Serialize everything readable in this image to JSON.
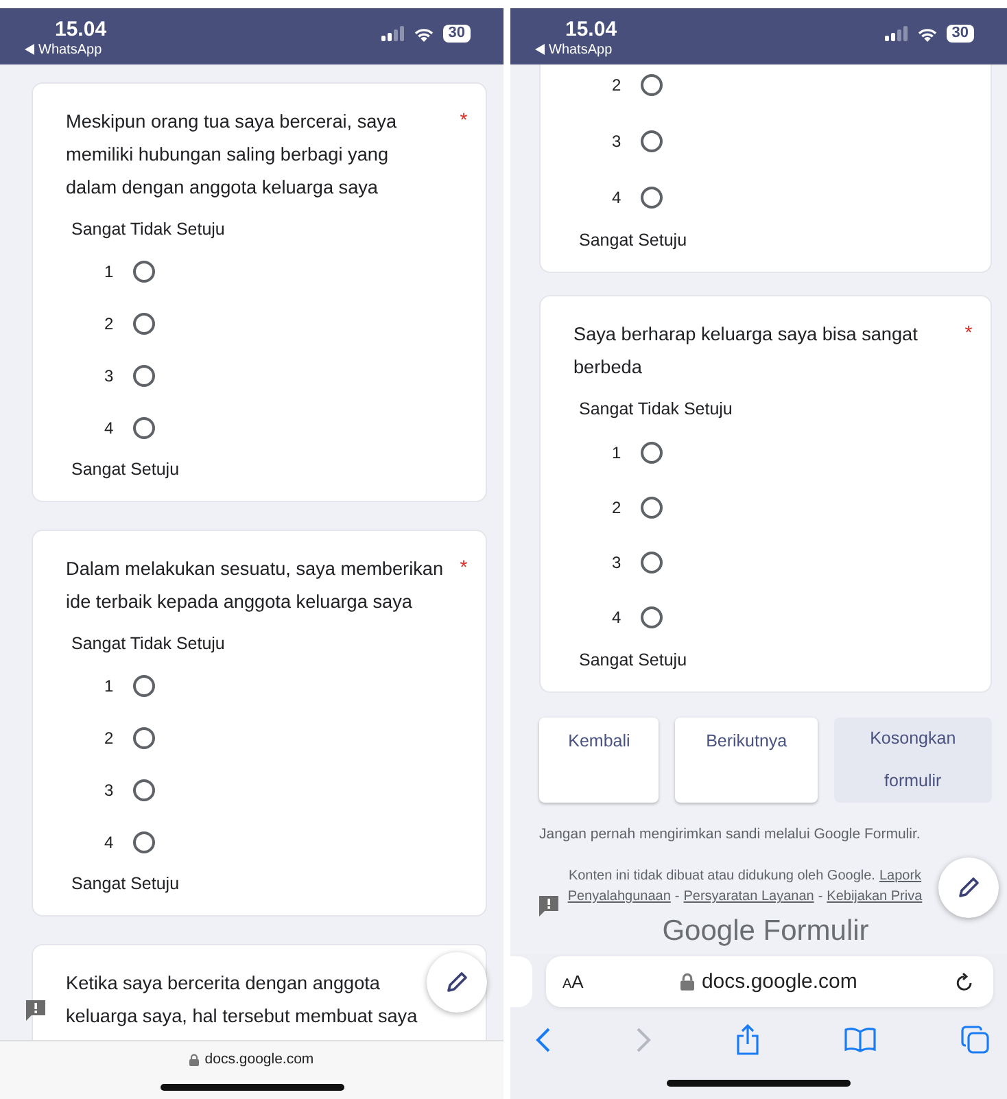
{
  "screens": [
    {
      "status_bar": {
        "time": "15.04",
        "back_app": "WhatsApp",
        "battery": "30"
      },
      "cards": [
        {
          "title": "Meskipun orang tua saya bercerai, saya\nmemiliki hubungan saling berbagi yang\ndalam dengan anggota keluarga saya",
          "required_mark": "*",
          "low_label": "Sangat Tidak Setuju",
          "options": [
            {
              "label": "1",
              "selected": false
            },
            {
              "label": "2",
              "selected": false
            },
            {
              "label": "3",
              "selected": false
            },
            {
              "label": "4",
              "selected": false
            }
          ],
          "high_label": "Sangat Setuju"
        },
        {
          "title": "Dalam melakukan sesuatu, saya memberikan\nide terbaik kepada anggota keluarga saya",
          "required_mark": "*",
          "low_label": "Sangat Tidak Setuju",
          "options": [
            {
              "label": "1",
              "selected": false
            },
            {
              "label": "2",
              "selected": false
            },
            {
              "label": "3",
              "selected": false
            },
            {
              "label": "4",
              "selected": false
            }
          ],
          "high_label": "Sangat Setuju"
        },
        {
          "title": "Ketika saya bercerita dengan anggota\nkeluarga saya, hal tersebut membuat saya"
        }
      ],
      "bottom_bar": {
        "kind": "compact",
        "url": "docs.google.com"
      }
    },
    {
      "status_bar": {
        "time": "15.04",
        "back_app": "WhatsApp",
        "battery": "30"
      },
      "cards": [
        {
          "cut_top": true,
          "options": [
            {
              "label": "2",
              "selected": false
            },
            {
              "label": "3",
              "selected": false
            },
            {
              "label": "4",
              "selected": false
            }
          ],
          "high_label": "Sangat Setuju"
        },
        {
          "title": "Saya berharap keluarga saya bisa sangat\nberbeda",
          "required_mark": "*",
          "low_label": "Sangat Tidak Setuju",
          "options": [
            {
              "label": "1",
              "selected": false
            },
            {
              "label": "2",
              "selected": false
            },
            {
              "label": "3",
              "selected": false
            },
            {
              "label": "4",
              "selected": false
            }
          ],
          "high_label": "Sangat Setuju"
        }
      ],
      "form_buttons": [
        {
          "label": "Kembali",
          "kind": "outlined"
        },
        {
          "label": "Berikutnya",
          "kind": "outlined"
        },
        {
          "label": "Kosongkan formulir",
          "kind": "flat"
        }
      ],
      "footer": {
        "warning": "Jangan pernah mengirimkan sandi melalui Google Formulir.",
        "disclaimer": "Konten ini tidak dibuat atau didukung oleh Google.",
        "first_link": "Lapork",
        "links": [
          "Penyalahgunaan",
          "Persyaratan Layanan",
          "Kebijakan Priva"
        ],
        "separator": "-",
        "logo_text": "Google Formulir"
      },
      "bottom_bar": {
        "kind": "expanded",
        "text_size": "AA",
        "url": "docs.google.com",
        "nav_buttons": [
          {
            "kind": "back",
            "disabled": false
          },
          {
            "kind": "forward",
            "disabled": true
          },
          {
            "kind": "share",
            "disabled": false
          },
          {
            "kind": "bookmarks",
            "disabled": false
          },
          {
            "kind": "tabs",
            "disabled": false
          }
        ]
      }
    }
  ]
}
